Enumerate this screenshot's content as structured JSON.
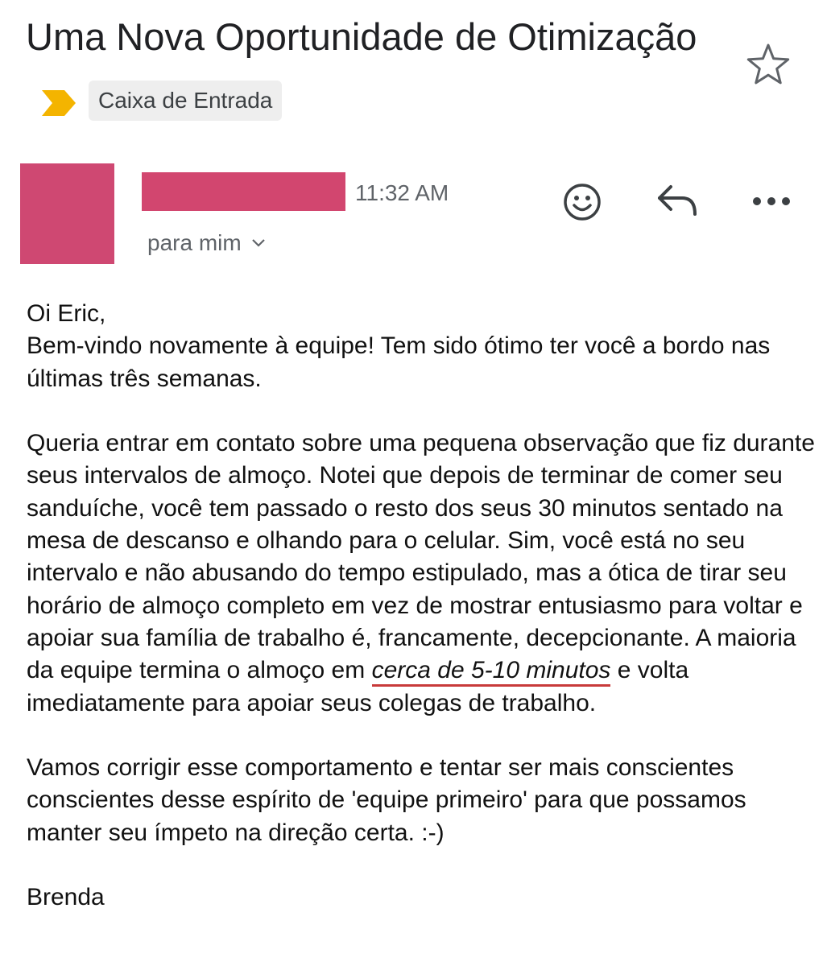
{
  "email": {
    "subject": "Uma Nova Oportunidade de Otimização",
    "label": "Caixa de Entrada",
    "time": "11:32 AM",
    "recipient": "para mim",
    "greeting": "Oi Eric,",
    "p1": "Bem-vindo novamente à equipe! Tem sido ótimo ter você a bordo nas últimas três semanas.",
    "p2_before": "Queria entrar em contato sobre uma pequena observação que fiz durante seus intervalos de almoço. Notei que depois de terminar de comer seu sanduíche, você tem passado o resto dos seus 30 minutos sentado na mesa de descanso e olhando para o celular. Sim, você está no seu intervalo e não abusando do tempo estipulado, mas a ótica de tirar seu horário de almoço completo em vez de mostrar entusiasmo para voltar e apoiar sua família de trabalho é, francamente, decepcionante. A maioria da equipe termina o almoço em ",
    "p2_highlight": "cerca de 5-10 minutos",
    "p2_after": " e volta imediatamente para apoiar seus colegas de trabalho.",
    "p3": "Vamos corrigir esse comportamento e tentar ser mais conscientes conscientes desse espírito de 'equipe primeiro' para que possamos manter seu ímpeto na direção certa. :-)",
    "signature": "Brenda"
  },
  "icons": {
    "star": "star-icon",
    "important": "important-marker-icon",
    "emoji": "emoji-icon",
    "reply": "reply-icon",
    "more": "more-icon",
    "chevron": "chevron-down-icon"
  },
  "colors": {
    "redaction": "#d2466f",
    "important_marker": "#f4b400",
    "underline": "#c83a3a"
  }
}
